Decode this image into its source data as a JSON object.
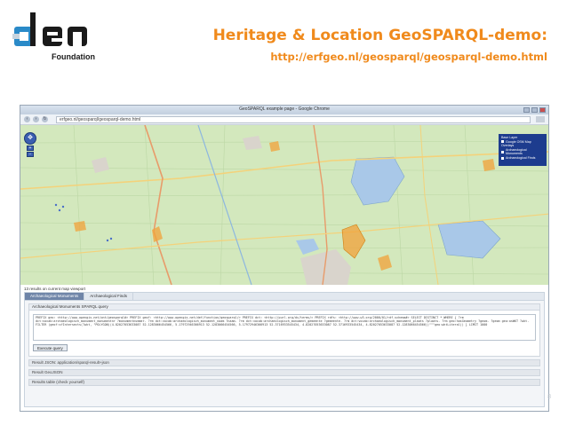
{
  "slide": {
    "logo_text": "den",
    "logo_subtext": "Foundation",
    "title": "Heritage & Location GeoSPARQL-demo:",
    "url": "http://erfgeo.nl/geosparql/geosparql-demo.html",
    "accent_color": "#f08a1c",
    "slide_number": "8"
  },
  "browser": {
    "window_title": "GeoSPARQL example page - Google Chrome",
    "address": "erfgeo.nl/geosparql/geosparql-demo.html",
    "nav_icons": [
      "back-icon",
      "forward-icon",
      "reload-icon"
    ]
  },
  "map": {
    "layer_switcher": {
      "base_layer_heading": "Base Layer",
      "base_layer": "Google OSM Map",
      "overlays_heading": "Overlays",
      "overlays": [
        "Archaeological Monuments",
        "Archaeological Finds"
      ]
    },
    "zoom_in": "+",
    "zoom_out": "−"
  },
  "results": {
    "summary": "13 results on current map viewport",
    "tabs": [
      "Archaeological Monuments",
      "Archaeological Finds"
    ],
    "active_tab": 0,
    "accordion_open": "Archaeological Monuments SPARQL query",
    "query_text": "PREFIX geo: <http://www.opengis.net/ont/geosparql#> PREFIX geof: <http://www.opengis.net/def/function/geosparql/> PREFIX dct: <http://purl.org/dc/terms/> PREFIX rdfs: <http://www.w3.org/2000/01/rdf-schema#> SELECT DISTINCT * WHERE { ?rm dct:vocab:archaeologisch_monument_monumentnr ?monumentnummer. ?rm dct:vocab:archaeologisch_monument_naam ?naam. ?rm dct:vocab:archaeologisch_monument_gemeente ?gemeente. ?rm dct:vocab:archaeologisch_monument_plaats ?plaats. ?rm geo:hasGeometry ?geom. ?geom geo:asWKT ?wkt. FILTER (geof:sfIntersects(?wkt, \"POLYGON((4.82027053633087 52.1283066454566, 5.17972946366913 52.1283066454566, 5.17972946366913 52.3716933545434, 4.82027053633087 52.3716933545434, 4.82027053633087 52.1283066454566))\"^^geo:wktLiteral)) } LIMIT 1000",
    "execute_label": "Execute query",
    "collapsed": [
      "Result JSON: application/sparql-result+json",
      "Result GeoJSON",
      "Results table (check yourself)"
    ]
  }
}
